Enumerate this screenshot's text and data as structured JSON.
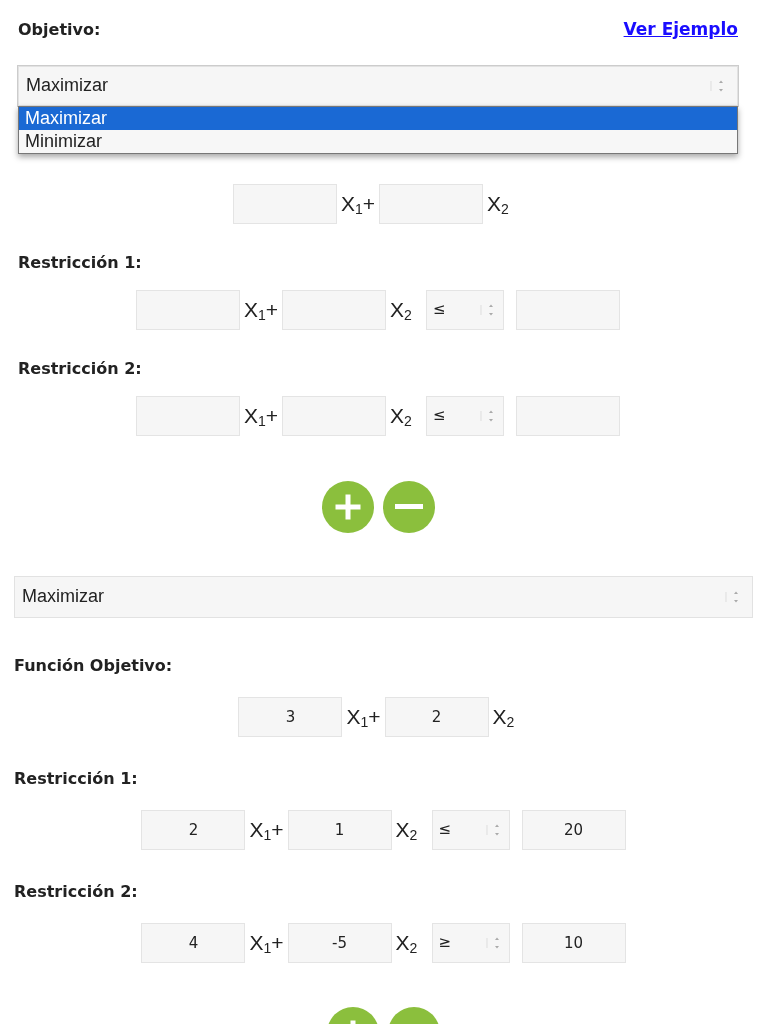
{
  "forms": [
    {
      "objective_label": "Objetivo:",
      "example_link": "Ver Ejemplo",
      "goal": {
        "value": "Maximizar",
        "expanded": true,
        "options": [
          {
            "label": "Maximizar",
            "selected": true
          },
          {
            "label": "Minimizar",
            "selected": false
          }
        ]
      },
      "function_variables": [
        "X$_{1}$+",
        "X$_{2}$"
      ],
      "constraints": [
        {
          "title": "Restricción 1:",
          "variables": [
            "X$_{1}$+",
            "X$_{2}$"
          ],
          "relation": "≤"
        },
        {
          "title": "Restricción 2:",
          "variables": [
            "X$_{1}$+",
            "X$_{2}$"
          ],
          "relation": "≤"
        }
      ],
      "buttons": [
        {
          "kind": "add"
        },
        {
          "kind": "remove"
        }
      ]
    },
    {
      "goal": {
        "value": "Maximizar",
        "expanded": false
      },
      "function_label": "Función Objetivo:",
      "function_coefficients": [
        "3",
        "2"
      ],
      "function_variables": [
        "X$_{1}$+",
        "X$_{2}$"
      ],
      "constraints": [
        {
          "title": "Restricción 1:",
          "coefficients": [
            "2",
            "1"
          ],
          "variables": [
            "X$_{1}$+",
            "X$_{2}$"
          ],
          "relation": "≤",
          "rhs": "20"
        },
        {
          "title": "Restricción 2:",
          "coefficients": [
            "4",
            "-5"
          ],
          "variables": [
            "X$_{1}$+",
            "X$_{2}$"
          ],
          "relation": "≥",
          "rhs": "10"
        }
      ],
      "buttons": [
        {
          "kind": "add"
        },
        {
          "kind": "remove"
        }
      ]
    }
  ]
}
